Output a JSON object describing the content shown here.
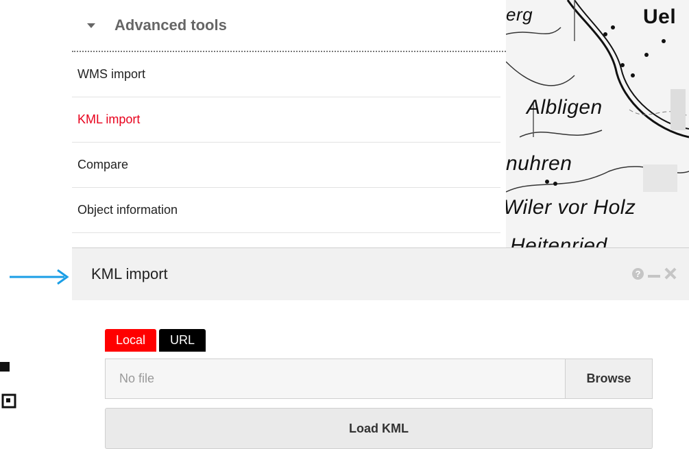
{
  "tools": {
    "title": "Advanced tools",
    "items": [
      {
        "label": "WMS import",
        "active": false
      },
      {
        "label": "KML import",
        "active": true
      },
      {
        "label": "Compare",
        "active": false
      },
      {
        "label": "Object information",
        "active": false
      }
    ]
  },
  "map": {
    "labels": [
      "erg",
      "Uel",
      "Albligen",
      "nuhren",
      "Wiler vor Holz",
      "Heitenried"
    ]
  },
  "popup": {
    "title": "KML import",
    "tabs": {
      "local": "Local",
      "url": "URL"
    },
    "file": {
      "placeholder": "No file",
      "browse": "Browse"
    },
    "load_button": "Load KML"
  },
  "colors": {
    "active": "#e8001c",
    "tab_local": "#ff0000",
    "tab_url": "#000000",
    "arrow": "#1a9ee6"
  },
  "icons": [
    "caret-down-icon",
    "help-icon",
    "minimize-icon",
    "close-icon",
    "arrow-right-icon"
  ]
}
